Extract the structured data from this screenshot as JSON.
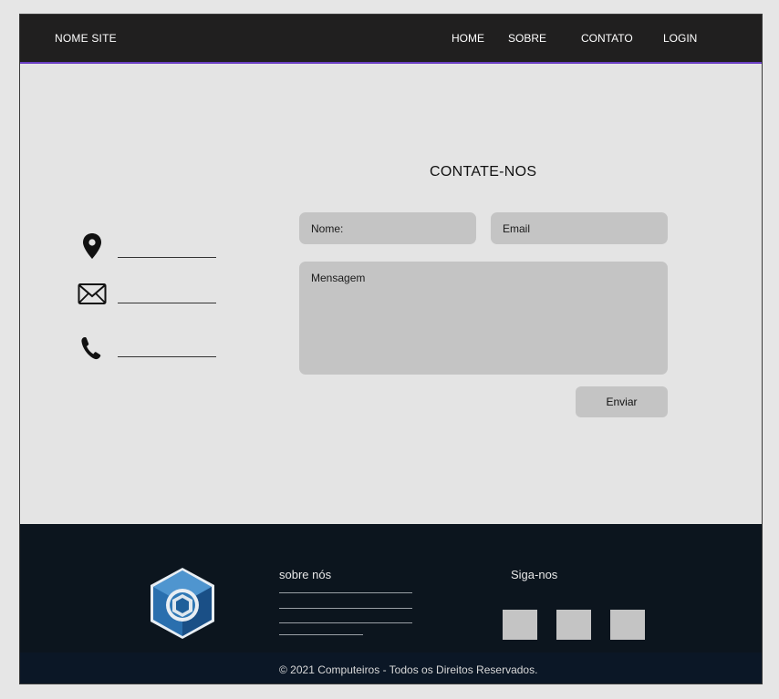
{
  "nav": {
    "brand": "NOME SITE",
    "links": [
      {
        "label": "HOME"
      },
      {
        "label": "SOBRE"
      },
      {
        "label": "CONTATO"
      },
      {
        "label": "LOGIN"
      }
    ],
    "accent_color": "#6b3fc4"
  },
  "contact": {
    "title": "CONTATE-NOS",
    "info_icons": [
      "location-pin-icon",
      "envelope-icon",
      "phone-icon"
    ],
    "form": {
      "name_placeholder": "Nome:",
      "email_placeholder": "Email",
      "message_placeholder": "Mensagem",
      "submit_label": "Enviar"
    }
  },
  "footer": {
    "logo_icon": "cube-logo-icon",
    "about_heading": "sobre nós",
    "follow_heading": "Siga-nos",
    "copyright": "© 2021 Computeiros - Todos os Direitos Reservados."
  }
}
